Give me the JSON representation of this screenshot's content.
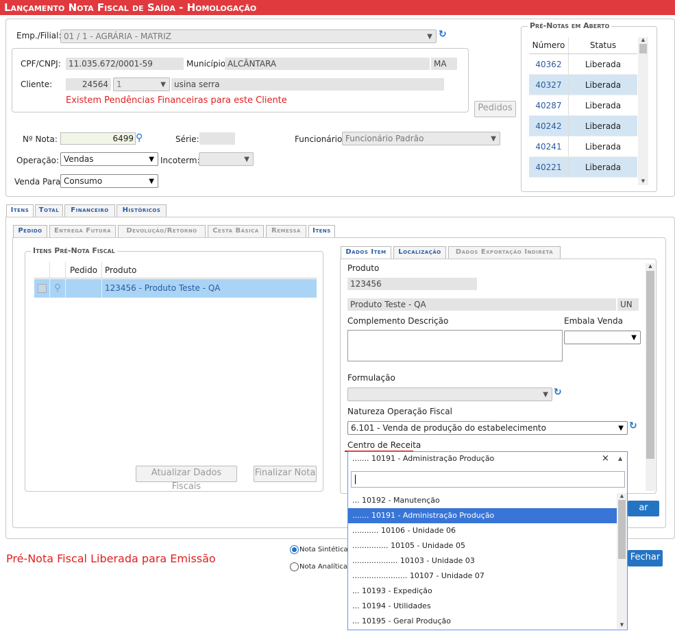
{
  "title": "Lançamento Nota Fiscal de Saída  - Homologação",
  "header": {
    "emp_label": "Emp./Filial:",
    "emp_value": "01 / 1 - AGRÁRIA - MATRIZ",
    "cpf_label": "CPF/CNPJ:",
    "cpf_value": "11.035.672/0001-59",
    "municipio_label": "Município:",
    "municipio_value": "ALCÂNTARA",
    "uf_value": "MA",
    "cliente_label": "Cliente:",
    "cliente_code": "24564",
    "cliente_seq": "1",
    "cliente_name": "usina serra",
    "pendencias": "Existem Pendências Financeiras para este Cliente",
    "pedidos_button": "Pedidos",
    "nota_label": "Nº Nota:",
    "nota_value": "6499",
    "serie_label": "Série:",
    "funcionario_label": "Funcionário:",
    "funcionario_value": "Funcionário Padrão",
    "operacao_label": "Operação:",
    "operacao_value": "Vendas",
    "incoterm_label": "Incoterm:",
    "venda_label": "Venda Para:",
    "venda_value": "Consumo"
  },
  "prenotas": {
    "legend": "Pré-Notas em Aberto",
    "col_numero": "Número",
    "col_status": "Status",
    "rows": [
      {
        "numero": "40362",
        "status": "Liberada"
      },
      {
        "numero": "40327",
        "status": "Liberada"
      },
      {
        "numero": "40287",
        "status": "Liberada"
      },
      {
        "numero": "40242",
        "status": "Liberada"
      },
      {
        "numero": "40241",
        "status": "Liberada"
      },
      {
        "numero": "40221",
        "status": "Liberada"
      }
    ]
  },
  "main_tabs": [
    "Itens",
    "Total",
    "Financeiro",
    "Históricos"
  ],
  "sub_tabs": [
    "Pedido",
    "Entrega Futura",
    "Devolução/Retorno",
    "Cesta Básica",
    "Remessa",
    "Itens"
  ],
  "itens_prenota": {
    "legend": "Itens Pré-Nota Fiscal",
    "col_pedido": "Pedido",
    "col_produto": "Produto",
    "row_produto": "123456 - Produto Teste - QA",
    "btn_atualizar": "Atualizar Dados Fiscais",
    "btn_finalizar": "Finalizar Nota"
  },
  "item_tabs": [
    "Dados Item",
    "Localização",
    "Dados Exportação Indireta"
  ],
  "dados_item": {
    "produto_label": "Produto",
    "produto_code": "123456",
    "produto_desc": "Produto Teste - QA",
    "unidade": "UN",
    "complemento_label": "Complemento Descrição",
    "embala_label": "Embala Venda",
    "formulacao_label": "Formulação",
    "natureza_label": "Natureza Operação Fiscal",
    "natureza_value": "6.101 - Venda de produção do estabelecimento",
    "centro_label": "Centro de Receita",
    "centro_value": "....... 10191 - Administração Produção",
    "clear": "×",
    "search_value": "",
    "options": [
      "... 10192 - Manutenção",
      "....... 10191 - Administração Produção",
      "........... 10106 - Unidade 06",
      "............... 10105 - Unidade 05",
      "................... 10103 - Unidade 03",
      "....................... 10107 - Unidade 07",
      "... 10193 - Expedição",
      "... 10194 - Utilidades",
      "... 10195 - Geral Produção"
    ],
    "btn_item": "ar Item"
  },
  "footer": {
    "status": "Pré-Nota Fiscal Liberada para Emissão",
    "radio_sintetica": "Nota Sintética",
    "radio_analitica": "Nota Analítica",
    "btn_fechar": "Fechar"
  },
  "colors": {
    "title_bg": "#e03a3e",
    "link_blue": "#2a5aa0",
    "highlight_row": "#d3e5f3",
    "dropdown_highlight": "#3875d7",
    "error_red": "#e02020"
  }
}
